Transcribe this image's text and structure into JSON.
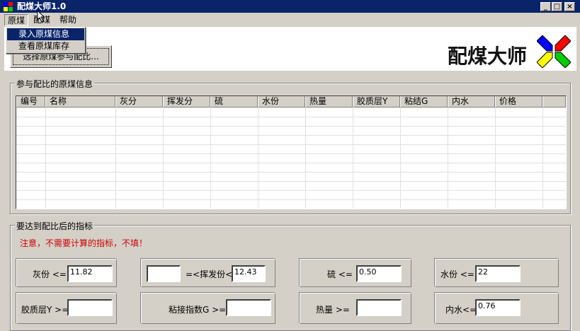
{
  "window": {
    "title": "配煤大师1.0",
    "minimize": "_",
    "maximize": "□",
    "close": "×"
  },
  "menu": {
    "items": [
      "原煤",
      "配煤",
      "帮助"
    ],
    "dropdown": [
      "录入原煤信息",
      "查看原煤库存"
    ]
  },
  "banner": {
    "brand": "配煤大师",
    "logo_colors": [
      "#0000ff",
      "#ff0000",
      "#ffff00",
      "#00cc00"
    ]
  },
  "select_button": "选择原煤参与配比...",
  "coal_group": {
    "title": "参与配比的原煤信息",
    "columns": [
      "编号",
      "名称",
      "灰分",
      "挥发分",
      "硫",
      "水份",
      "热量",
      "胶质层Y",
      "粘结G",
      "内水",
      "价格",
      ""
    ],
    "rows": []
  },
  "target_group": {
    "title": "要达到配比后的指标",
    "notice": "注意，不需要计算的指标，不填！",
    "notice_color": "#cc0000",
    "fields": {
      "ash": {
        "label": "灰份 <=",
        "value": "11.82"
      },
      "volatile_min": {
        "value": ""
      },
      "volatile": {
        "label": "=<挥发份<=",
        "value": "12.43"
      },
      "sulfur": {
        "label": "硫 <=",
        "value": "0.50"
      },
      "moisture": {
        "label": "水份 <=",
        "value": "22"
      },
      "plastic": {
        "label": "胶质层Y >=",
        "value": ""
      },
      "caking": {
        "label": "粘接指数G >=",
        "value": ""
      },
      "heat": {
        "label": "热量 >=",
        "value": ""
      },
      "inner_moisture": {
        "label": "内水<=",
        "value": "0.76"
      }
    }
  }
}
